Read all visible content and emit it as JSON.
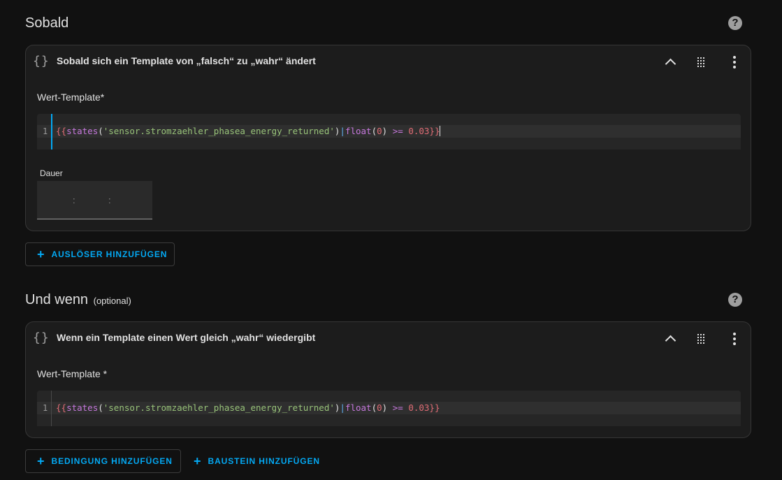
{
  "trigger_section": {
    "title": "Sobald",
    "help_icon": "help-circle-icon",
    "card": {
      "icon": "code-braces-icon",
      "icon_glyph": "{}",
      "title": "Sobald sich ein Template von „falsch“ zu „wahr“ ändert",
      "field_label": "Wert-Template*",
      "line_number": "1",
      "code_tokens": [
        {
          "t": "{{",
          "c": "tok-brace"
        },
        {
          "t": "states",
          "c": "tok-func"
        },
        {
          "t": "(",
          "c": "tok-paren"
        },
        {
          "t": "'sensor.stromzaehler_phasea_energy_returned'",
          "c": "tok-string"
        },
        {
          "t": ")",
          "c": "tok-paren"
        },
        {
          "t": "|",
          "c": "tok-pipe"
        },
        {
          "t": "float",
          "c": "tok-func"
        },
        {
          "t": "(",
          "c": "tok-paren"
        },
        {
          "t": "0",
          "c": "tok-num"
        },
        {
          "t": ")",
          "c": "tok-paren"
        },
        {
          "t": " ",
          "c": "tok-paren"
        },
        {
          "t": ">=",
          "c": "tok-op"
        },
        {
          "t": " ",
          "c": "tok-paren"
        },
        {
          "t": "0.03",
          "c": "tok-num"
        },
        {
          "t": "}}",
          "c": "tok-brace"
        }
      ],
      "duration_label": "Dauer",
      "duration_separator": ":"
    },
    "add_button_label": "AUSLÖSER HINZUFÜGEN"
  },
  "condition_section": {
    "title": "Und wenn",
    "title_suffix": "(optional)",
    "help_icon": "help-circle-icon",
    "card": {
      "icon": "code-braces-icon",
      "icon_glyph": "{}",
      "title": "Wenn ein Template einen Wert gleich „wahr“ wiedergibt",
      "field_label": "Wert-Template *",
      "line_number": "1",
      "code_tokens": [
        {
          "t": "{{",
          "c": "tok-brace"
        },
        {
          "t": "states",
          "c": "tok-func"
        },
        {
          "t": "(",
          "c": "tok-paren"
        },
        {
          "t": "'sensor.stromzaehler_phasea_energy_returned'",
          "c": "tok-string"
        },
        {
          "t": ")",
          "c": "tok-paren"
        },
        {
          "t": "|",
          "c": "tok-pipe"
        },
        {
          "t": "float",
          "c": "tok-func"
        },
        {
          "t": "(",
          "c": "tok-paren"
        },
        {
          "t": "0",
          "c": "tok-num"
        },
        {
          "t": ")",
          "c": "tok-paren"
        },
        {
          "t": " ",
          "c": "tok-paren"
        },
        {
          "t": ">=",
          "c": "tok-op"
        },
        {
          "t": " ",
          "c": "tok-paren"
        },
        {
          "t": "0.03",
          "c": "tok-num"
        },
        {
          "t": "}}",
          "c": "tok-brace"
        }
      ]
    },
    "add_condition_label": "BEDINGUNG HINZUFÜGEN",
    "add_block_label": "BAUSTEIN HINZUFÜGEN"
  },
  "colors": {
    "accent": "#03a9f4",
    "background": "#111111",
    "card": "#1c1c1c",
    "focus_border": "#03a9f4"
  },
  "icons": {
    "collapse": "chevron-up-icon",
    "drag": "drag-grip-icon",
    "menu": "dots-vertical-icon",
    "add": "plus-icon"
  }
}
